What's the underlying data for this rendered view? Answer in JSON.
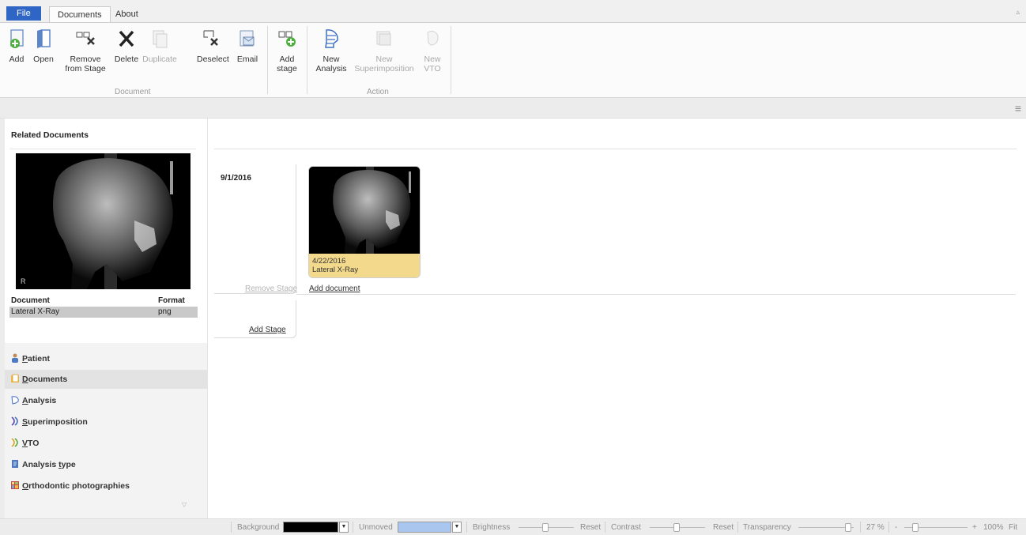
{
  "tabs": {
    "file": "File",
    "documents": "Documents",
    "about": "About"
  },
  "ribbon": {
    "add": "Add",
    "open": "Open",
    "remove_from_stage_1": "Remove",
    "remove_from_stage_2": "from Stage",
    "delete": "Delete",
    "duplicate": "Duplicate",
    "deselect": "Deselect",
    "email": "Email",
    "add_stage_1": "Add",
    "add_stage_2": "stage",
    "group_document": "Document",
    "new_analysis_1": "New",
    "new_analysis_2": "Analysis",
    "new_superimposition_1": "New",
    "new_superimposition_2": "Superimposition",
    "new_vto_1": "New",
    "new_vto_2": "VTO",
    "group_action": "Action"
  },
  "related": {
    "title": "Related Documents",
    "col_document": "Document",
    "col_format": "Format",
    "rows": [
      {
        "document": "Lateral X-Ray",
        "format": "png"
      }
    ]
  },
  "nav": [
    {
      "first": "P",
      "rest": "atient"
    },
    {
      "first": "D",
      "rest": "ocuments"
    },
    {
      "first": "A",
      "rest": "nalysis"
    },
    {
      "first": "S",
      "rest": "uperimposition"
    },
    {
      "first": "V",
      "rest": "TO"
    },
    {
      "pre": "Analysis ",
      "first": "t",
      "rest": "ype"
    },
    {
      "first": "O",
      "rest": "rthodontic photographies"
    }
  ],
  "stage": {
    "date": "9/1/2016",
    "remove_stage": "Remove Stage",
    "add_stage": "Add Stage",
    "add_document": "Add document",
    "card": {
      "date": "4/22/2016",
      "title": "Lateral X-Ray"
    }
  },
  "statusbar": {
    "background": "Background",
    "unmoved": "Unmoved",
    "brightness": "Brightness",
    "reset1": "Reset",
    "contrast": "Contrast",
    "reset2": "Reset",
    "transparency": "Transparency",
    "transparency_value": "27 %",
    "zoom_minus": "-",
    "zoom_plus": "+",
    "zoom_value": "100%",
    "fit": "Fit"
  },
  "colors": {
    "file_tab": "#2f66c5",
    "card_info": "#f3d98b",
    "unmoved_swatch": "#a9c6ee",
    "background_swatch": "#000000"
  }
}
